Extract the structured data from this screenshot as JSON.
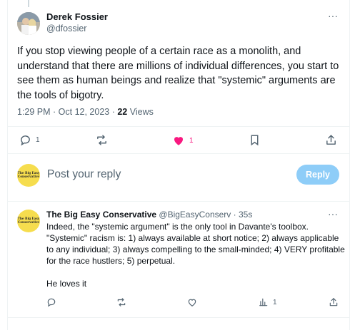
{
  "tweet": {
    "author_name": "Derek Fossier",
    "author_handle": "@dfossier",
    "more_label": "···",
    "text": "If you stop viewing people of a certain race as a monolith, and understand that there are millions of individual differences, you start to see them as human beings and realize that \"systemic\" arguments are the tools of bigotry.",
    "timestamp": "1:29 PM · Oct 12, 2023 · ",
    "views_count": "22",
    "views_label": " Views",
    "actions": {
      "reply_count": "1",
      "retweet_count": "",
      "like_count": "1",
      "like_color": "#f91880"
    }
  },
  "reply_box": {
    "avatar_text": "The Big Easy Conservative",
    "placeholder": "Post your reply",
    "button_label": "Reply",
    "button_color": "#8ecdf8"
  },
  "comment": {
    "avatar_text": "The Big Easy Conservative",
    "author_name": "The Big Easy Conservative",
    "author_handle": "@BigEasyConserv",
    "dot": " · ",
    "time": "35s",
    "more_label": "···",
    "text": "Indeed, the \"systemic argument\" is the only tool in Davante's toolbox. \"Systemic\" racism is: 1) always available at short notice; 2) always applicable to any individual; 3) always compelling to the small-minded; 4) VERY profitable for the race hustlers; 5) perpetual.",
    "text2": "He loves it",
    "actions": {
      "views_count": "1"
    }
  },
  "icons": [
    "reply-icon",
    "retweet-icon",
    "heart-icon",
    "bookmark-icon",
    "share-icon",
    "views-chart-icon"
  ]
}
